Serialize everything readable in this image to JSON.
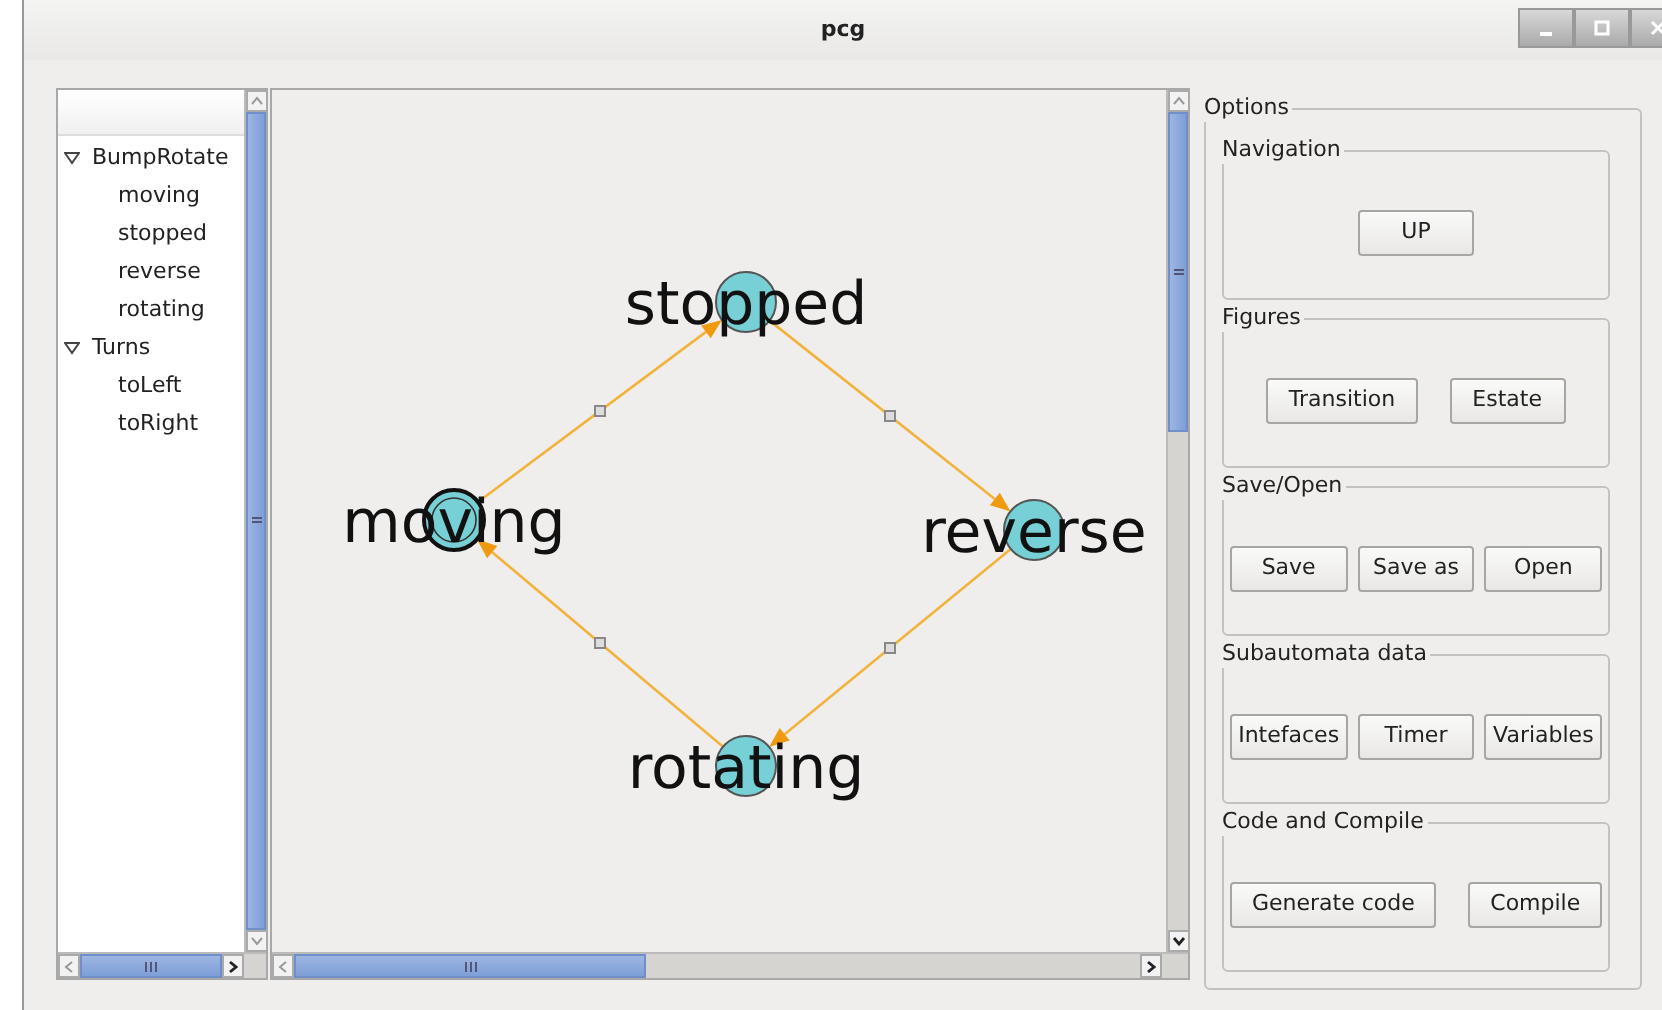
{
  "window": {
    "title": "pcg"
  },
  "tree": [
    {
      "label": "BumpRotate",
      "expanded": true,
      "children": [
        {
          "label": "moving"
        },
        {
          "label": "stopped"
        },
        {
          "label": "reverse"
        },
        {
          "label": "rotating"
        }
      ]
    },
    {
      "label": "Turns",
      "expanded": true,
      "children": [
        {
          "label": "toLeft"
        },
        {
          "label": "toRight"
        }
      ]
    }
  ],
  "diagram": {
    "states": [
      {
        "name": "moving",
        "initial": true,
        "outgoing": true
      },
      {
        "name": "stopped",
        "initial": false,
        "outgoing": true
      },
      {
        "name": "reverse",
        "initial": false,
        "outgoing": true
      },
      {
        "name": "rotating",
        "initial": false,
        "outgoing": true
      }
    ]
  },
  "options": {
    "title": "Options",
    "groups": [
      {
        "title": "Navigation",
        "buttons": [
          "UP"
        ]
      },
      {
        "title": "Figures",
        "buttons": [
          "Transition",
          "Estate"
        ]
      },
      {
        "title": "Save/Open",
        "buttons": [
          "Save",
          "Save as",
          "Open"
        ]
      },
      {
        "title": "Subautomata data",
        "buttons": [
          "Intefaces",
          "Timer",
          "Variables"
        ]
      },
      {
        "title": "Code and Compile",
        "buttons": [
          "Generate code",
          "Compile"
        ]
      }
    ]
  }
}
